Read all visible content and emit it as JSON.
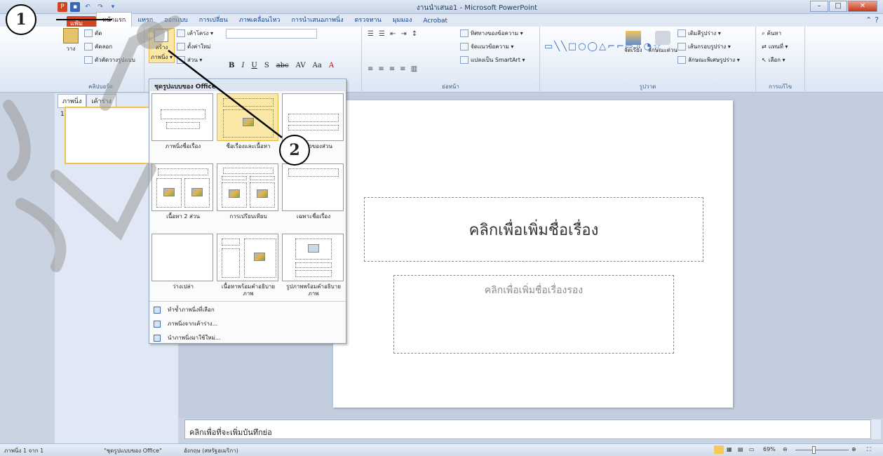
{
  "window": {
    "title": "งานนำเสนอ1 - Microsoft PowerPoint",
    "qat_icons": [
      "powerpoint-logo-icon",
      "save-icon",
      "undo-icon",
      "redo-icon",
      "customize-icon"
    ]
  },
  "tabs": [
    "แฟ้ม",
    "หน้าแรก",
    "แทรก",
    "ออกแบบ",
    "การเปลี่ยน",
    "ภาพเคลื่อนไหว",
    "การนำเสนอภาพนิ่ง",
    "ตรวจทาน",
    "มุมมอง",
    "Acrobat"
  ],
  "ribbon": {
    "clipboard": {
      "paste": "วาง",
      "cut": "ตัด",
      "copy": "คัดลอก",
      "format_painter": "ตัวคัดวางรูปแบบ",
      "label": "คลิปบอร์ด"
    },
    "slides": {
      "new_slide": "สร้าง",
      "new_slide_line2": "ภาพนิ่ง ▾",
      "layout": "เค้าโครง ▾",
      "reset": "ตั้งค่าใหม่",
      "section": "ส่วน ▾"
    },
    "font": {
      "bold": "B",
      "italic": "I",
      "underline": "U",
      "shadow": "S",
      "strike": "abc",
      "spacing": "AV",
      "case": "Aa",
      "color": "A"
    },
    "paragraph": {
      "direction": "ทิศทางของข้อความ ▾",
      "align": "จัดแนวข้อความ ▾",
      "smartart": "แปลงเป็น SmartArt ▾",
      "label": "ย่อหน้า"
    },
    "drawing": {
      "arrange": "จัดเรียง",
      "quick_styles": "ลักษณะด่วน",
      "fill": "เติมสีรูปร่าง ▾",
      "outline": "เส้นกรอบรูปร่าง ▾",
      "effects": "ลักษณะพิเศษรูปร่าง ▾",
      "label": "รูปวาด"
    },
    "editing": {
      "find": "ค้นหา",
      "replace": "แทนที่ ▾",
      "select": "เลือก ▾",
      "label": "การแก้ไข"
    }
  },
  "panel": {
    "tab_slides": "ภาพนิ่ง",
    "tab_outline": "เค้าร่าง",
    "slide_number": "1"
  },
  "slide": {
    "title_placeholder": "คลิกเพื่อเพิ่มชื่อเรื่อง",
    "subtitle_placeholder": "คลิกเพื่อเพิ่มชื่อเรื่องรอง"
  },
  "notes": {
    "placeholder": "คลิกเพื่อที่จะเพิ่มบันทึกย่อ"
  },
  "menu": {
    "header": "ชุดรูปแบบของ Office",
    "layouts": [
      "ภาพนิ่งชื่อเรื่อง",
      "ชื่อเรื่องและเนื้อหา",
      "ส่วนหัวของส่วน",
      "เนื้อหา 2 ส่วน",
      "การเปรียบเทียบ",
      "เฉพาะชื่อเรื่อง",
      "ว่างเปล่า",
      "เนื้อหาพร้อมคำอธิบายภาพ",
      "รูปภาพพร้อมคำอธิบายภาพ"
    ],
    "items": [
      "ทำซ้ำภาพนิ่งที่เลือก",
      "ภาพนิ่งจากเค้าร่าง...",
      "นำภาพนิ่งมาใช้ใหม่..."
    ]
  },
  "status": {
    "slide_pos": "ภาพนิ่ง 1 จาก 1",
    "theme": "\"ชุดรูปแบบของ Office\"",
    "language": "อังกฤษ (สหรัฐอเมริกา)",
    "zoom": "69%"
  },
  "callouts": [
    "1",
    "2"
  ],
  "colors": {
    "file_tab": "#cf4520",
    "ribbon_bg": "#dbe6f4",
    "selected_layout": "#fbe8a6",
    "watermark": "#9a9a9a"
  }
}
